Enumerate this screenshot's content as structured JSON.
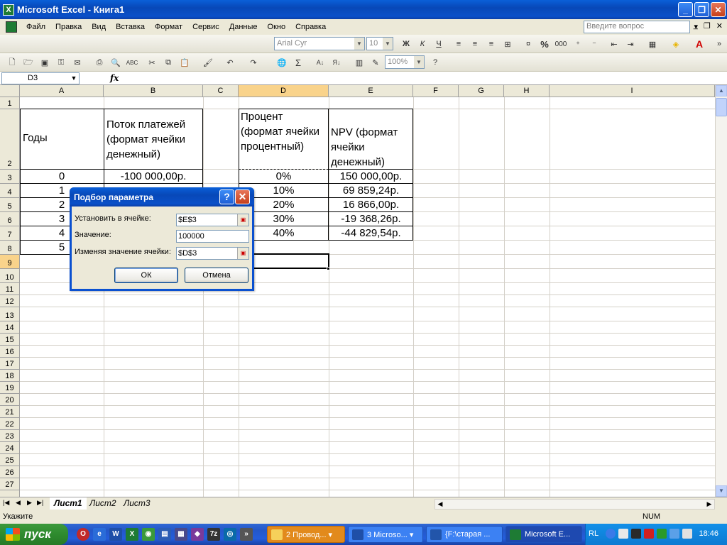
{
  "window": {
    "title": "Microsoft Excel - Книга1",
    "app_icon": "excel-icon",
    "buttons": [
      "minimize",
      "restore",
      "close"
    ]
  },
  "menu": {
    "items": [
      "Файл",
      "Правка",
      "Вид",
      "Вставка",
      "Формат",
      "Сервис",
      "Данные",
      "Окно",
      "Справка"
    ],
    "help_placeholder": "Введите вопрос"
  },
  "toolbar": {
    "font_name": "Arial Cyr",
    "font_size": "10",
    "zoom": "100%",
    "bold": "Ж",
    "italic": "К",
    "underline": "Ч",
    "percent": "%",
    "thousands": "000",
    "sum": "Σ"
  },
  "formula_bar": {
    "name_box": "D3",
    "fx": "fx",
    "content": ""
  },
  "columns": [
    "A",
    "B",
    "C",
    "D",
    "E",
    "F",
    "G",
    "H",
    "I"
  ],
  "selected_column": "D",
  "rows": [
    "1",
    "2",
    "3",
    "4",
    "5",
    "6",
    "7",
    "8",
    "9",
    "10",
    "11",
    "12",
    "13",
    "14",
    "15",
    "16",
    "17",
    "18",
    "19",
    "20",
    "21",
    "22",
    "23",
    "24",
    "25",
    "26",
    "27"
  ],
  "selected_row": "9",
  "cells": {
    "A2": "Годы",
    "B2": "Поток платежей (формат ячейки денежный)",
    "D2": "Процент (формат ячейки процентный)",
    "E2": "NPV (формат ячейки денежный)",
    "A3": "0",
    "A4": "1",
    "A5": "2",
    "A6": "3",
    "A7": "4",
    "A8": "5",
    "B3": "-100 000,00р.",
    "D3": "0%",
    "D4": "10%",
    "D5": "20%",
    "D6": "30%",
    "D7": "40%",
    "E3": "150 000,00р.",
    "E4": "69 859,24р.",
    "E5": "16 866,00р.",
    "E6": "-19 368,26р.",
    "E7": "-44 829,54р."
  },
  "dialog": {
    "title": "Подбор параметра",
    "help": "?",
    "close": "✕",
    "set_cell_label": "Установить в ячейке:",
    "set_cell_value": "$E$3",
    "value_label": "Значение:",
    "value_value": "100000",
    "changing_cell_label": "Изменяя значение ячейки:",
    "changing_cell_value": "$D$3",
    "ok": "ОК",
    "cancel": "Отмена"
  },
  "sheets": {
    "tabs": [
      "Лист1",
      "Лист2",
      "Лист3"
    ],
    "active": "Лист1"
  },
  "status": {
    "left": "Укажите",
    "num": "NUM"
  },
  "taskbar": {
    "start": "пуск",
    "tasks": [
      "2 Провод...",
      "3 Microso...",
      "{F:\\старая ...",
      "Microsoft E..."
    ],
    "lang": "RL",
    "clock": "18:46"
  }
}
